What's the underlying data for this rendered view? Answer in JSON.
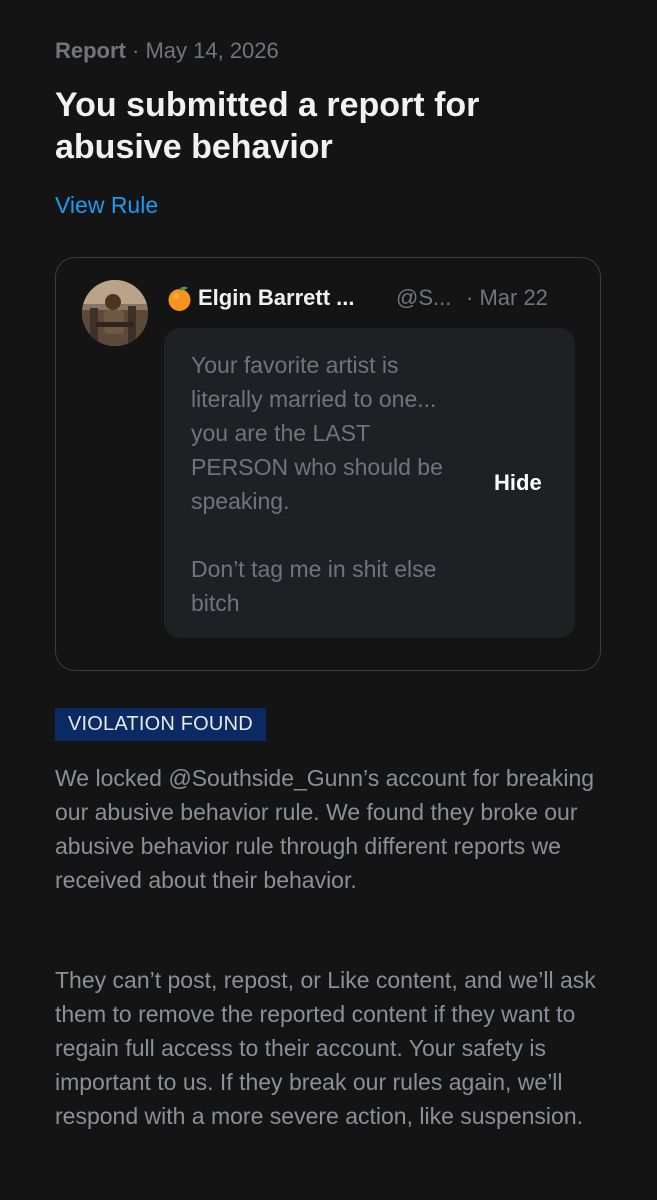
{
  "header": {
    "kind": "Report",
    "separator": " · ",
    "date": "May 14, 2026",
    "title": "You submitted a report for abusive behavior",
    "view_rule": "View Rule"
  },
  "reported_post": {
    "author_name": "Elgin Barrett ...",
    "author_emoji_icon": "orange-emoji",
    "handle": "@S...",
    "date": "· Mar 22",
    "text": "Your favorite artist is literally married to one... you are the LAST PERSON who should be speaking.\n\nDon’t tag me in shit else bitch",
    "hide_label": "Hide"
  },
  "result": {
    "badge": "VIOLATION FOUND",
    "badge_color": "#0b2a63",
    "paragraph_1": "We locked @Southside_Gunn’s account for breaking our abusive behavior rule. We found they broke our abusive behavior rule through different reports we received about their behavior.",
    "paragraph_2": "They can’t post, repost, or Like content, and we’ll ask them to remove the reported content if they want to regain full access to their account. Your safety is important to us. If they break our rules again, we’ll respond with a more severe action, like suspension."
  },
  "colors": {
    "background": "#141414",
    "accent_link": "#1d9bf0",
    "muted_text": "#71767b"
  }
}
